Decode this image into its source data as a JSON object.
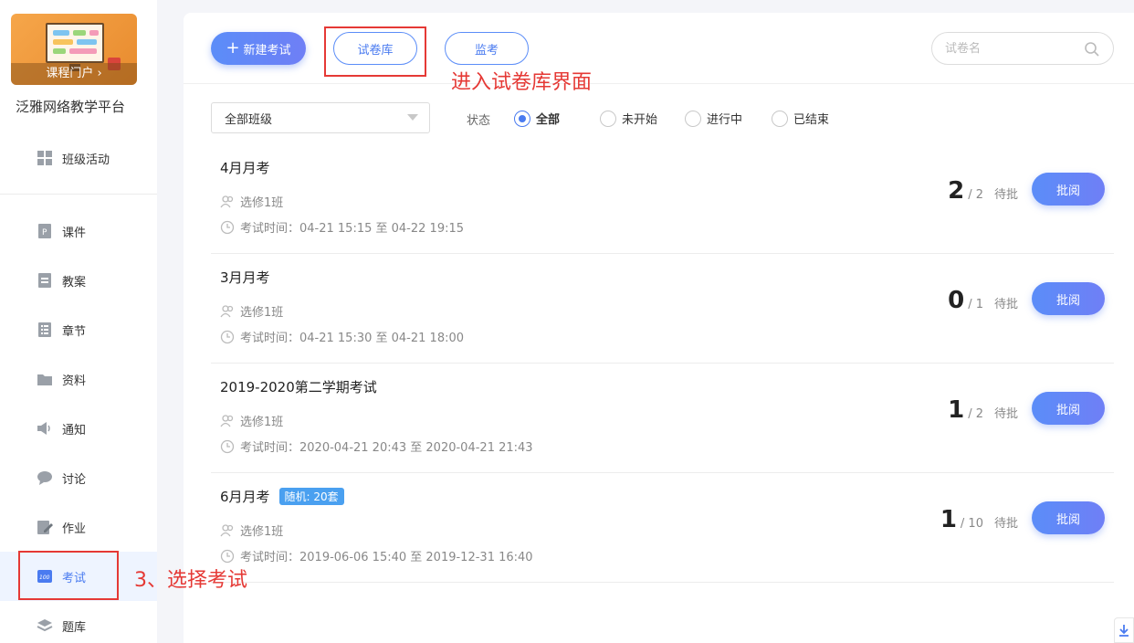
{
  "sidebar": {
    "course_portal": "课程门户 ›",
    "platform_name": "泛雅网络教学平台",
    "items": [
      {
        "label": "班级活动",
        "icon": "grid-icon"
      },
      {
        "label": "课件",
        "icon": "ppt-icon"
      },
      {
        "label": "教案",
        "icon": "lesson-plan-icon"
      },
      {
        "label": "章节",
        "icon": "list-icon"
      },
      {
        "label": "资料",
        "icon": "folder-icon"
      },
      {
        "label": "通知",
        "icon": "speaker-icon"
      },
      {
        "label": "讨论",
        "icon": "chat-icon"
      },
      {
        "label": "作业",
        "icon": "edit-icon"
      },
      {
        "label": "考试",
        "icon": "exam-icon"
      },
      {
        "label": "题库",
        "icon": "layers-icon"
      }
    ],
    "active_item": "考试"
  },
  "toolbar": {
    "new_exam": "新建考试",
    "paper_library": "试卷库",
    "proctor": "监考",
    "search_placeholder": "试卷名"
  },
  "filters": {
    "class_select": "全部班级",
    "status_label": "状态",
    "status_options": [
      "全部",
      "未开始",
      "进行中",
      "已结束"
    ],
    "selected_status": "全部"
  },
  "exams": [
    {
      "title": "4月月考",
      "badge": "",
      "class": "选修1班",
      "time": "考试时间：04-21 15:15 至 04-22 19:15",
      "reviewed": "2",
      "total": "/ 2",
      "pending": "待批",
      "action": "批阅"
    },
    {
      "title": "3月月考",
      "badge": "",
      "class": "选修1班",
      "time": "考试时间：04-21 15:30 至 04-21 18:00",
      "reviewed": "0",
      "total": "/ 1",
      "pending": "待批",
      "action": "批阅"
    },
    {
      "title": "2019-2020第二学期考试",
      "badge": "",
      "class": "选修1班",
      "time": "考试时间：2020-04-21 20:43 至 2020-04-21 21:43",
      "reviewed": "1",
      "total": "/ 2",
      "pending": "待批",
      "action": "批阅"
    },
    {
      "title": "6月月考",
      "badge": "随机: 20套",
      "class": "选修1班",
      "time": "考试时间：2019-06-06 15:40 至 2019-12-31 16:40",
      "reviewed": "1",
      "total": "/ 10",
      "pending": "待批",
      "action": "批阅"
    }
  ],
  "annotations": {
    "paper_library_note": "进入试卷库界面",
    "exam_note": "3、选择考试"
  },
  "colors": {
    "accent": "#5b8df8",
    "annotation_red": "#e53935"
  }
}
